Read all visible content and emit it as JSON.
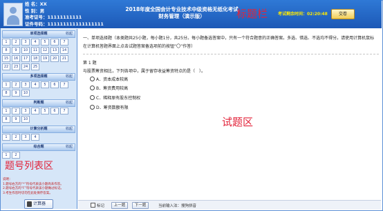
{
  "header": {
    "name_line": "姓 名：XX",
    "gender_line": "性 别：男",
    "ticket_line": "准考证号：11111111111",
    "id_line": "证件号码：111111111111111111",
    "title_line1": "2018年度全国会计专业技术中级资格无纸化考试",
    "title_line2": "财务管理（演示版）",
    "area_label": "标题栏",
    "timer": "考试剩余时间：02:20:48",
    "submit_label": "交卷"
  },
  "sidebar": {
    "collapse_label": "收起",
    "sections": [
      {
        "title": "单项选择题",
        "questions": [
          "1",
          "2",
          "3",
          "4",
          "5",
          "6",
          "7",
          "8",
          "9",
          "10",
          "11",
          "12",
          "13",
          "14",
          "15",
          "16",
          "17",
          "18",
          "19",
          "20",
          "21",
          "22",
          "23",
          "24",
          "25"
        ]
      },
      {
        "title": "多项选择题",
        "questions": [
          "1",
          "2",
          "3",
          "4",
          "5",
          "6",
          "7",
          "8",
          "9",
          "10"
        ]
      },
      {
        "title": "判断题",
        "questions": [
          "1",
          "2",
          "3",
          "4",
          "5",
          "6",
          "7",
          "8",
          "9",
          "10"
        ]
      },
      {
        "title": "计算分析题",
        "questions": [
          "1",
          "2",
          "3",
          "4"
        ]
      },
      {
        "title": "综合题",
        "questions": [
          "1",
          "2"
        ]
      }
    ],
    "area_label": "题号列表区",
    "notes_title": "说明：",
    "note1": "1.题号右方的“*”符号代表该小题尚未作答。",
    "note2": "2.题号右方的“F”符号代表该小题做过标记。",
    "note3": "3.考生作答时切勿在此处保存答案。",
    "calc_label": "计算器"
  },
  "main": {
    "instructions": "一、单项选择题（本类题共25小题，每小题1分，共25分。每小题备选答案中，只有一个符合题意的正确答案。多选、错选、不选均不得分。请使用计算机鼠标在计算机答题界面上点击试题答案备选项前的按钮“〇”作答）",
    "question_number": "第 1 题",
    "question_text": "与股票筹资相比，下列各项中，属于留存收益筹资特点的是（　）。",
    "options": [
      "A．资本成本较高",
      "B．筹资费用较高",
      "C．稀释原有股东控制权",
      "D．筹资数额有限"
    ],
    "area_label": "试题区"
  },
  "toolbar": {
    "mark_label": "标记",
    "prev_label": "上一题",
    "next_label": "下一题",
    "ime_label": "当前输入法：搜狗拼音"
  }
}
